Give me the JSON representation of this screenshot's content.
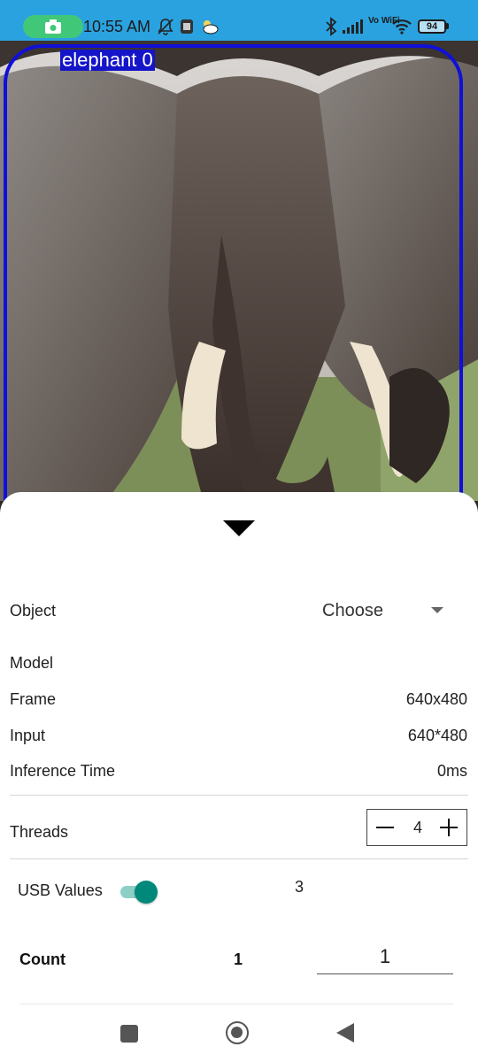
{
  "status_bar": {
    "time": "10:55 AM",
    "vowifi": "Vo WiFi",
    "battery": "94",
    "icons": [
      "camera-record-icon",
      "bell-off-icon",
      "screenshot-icon",
      "weather-icon",
      "bluetooth-icon",
      "signal-icon",
      "wifi-icon",
      "battery-icon"
    ]
  },
  "camera": {
    "detection_label": "elephant 0",
    "box_color": "#1010d8"
  },
  "sheet": {
    "object_label": "Object",
    "object_select": "Choose",
    "model_label": "Model",
    "frame_label": "Frame",
    "frame_value": "640x480",
    "input_label": "Input",
    "input_value": "640*480",
    "inference_label": "Inference Time",
    "inference_value": "0ms",
    "threads_label": "Threads",
    "threads_value": "4",
    "usb_label": "USB Values",
    "usb_toggle_on": true,
    "usb_value": "3",
    "count_label": "Count",
    "count_value": "1",
    "count_input": "1"
  },
  "colors": {
    "status_bar": "#2aa2df",
    "accent": "#00897b",
    "detect_box": "#1010d8"
  },
  "navbar": {
    "icons": [
      "recents-square-icon",
      "home-circle-icon",
      "back-triangle-icon"
    ]
  }
}
